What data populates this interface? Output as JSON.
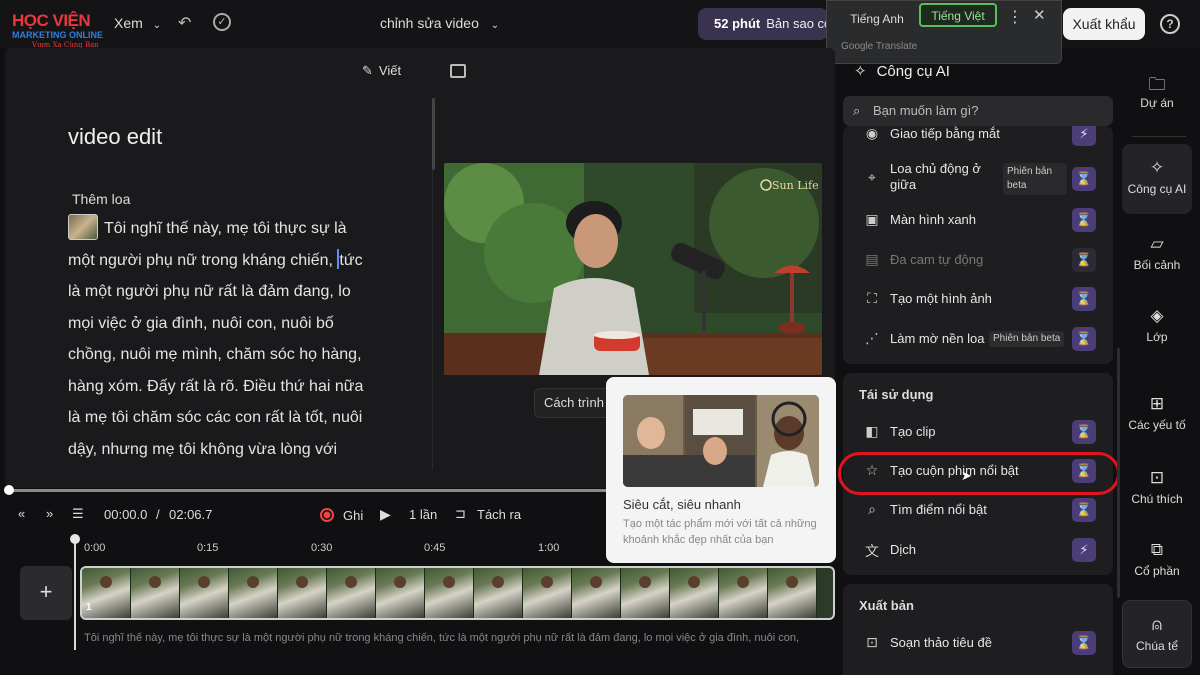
{
  "topbar": {
    "logo": {
      "line1": "HỌC VIỆN",
      "line2": "MARKETING ONLINE",
      "line3": "Vươn Xa Cùng Bạn"
    },
    "view_menu": "Xem",
    "document_title": "chỉnh sửa video",
    "duration": "52 phút",
    "duration_suffix": "Bản sao công",
    "export_label": "Xuất khẩu",
    "help_label": "?"
  },
  "translate_popup": {
    "lang_source": "Tiếng Anh",
    "lang_target": "Tiếng Việt",
    "brand": "Google Translate"
  },
  "editor": {
    "write_label": "Viết",
    "title": "video edit",
    "speaker": "Thêm loa",
    "transcript_before_cursor": "Tôi nghĩ thế này, mẹ tôi thực sự là một người phụ nữ trong kháng chiến, ",
    "transcript_after_cursor": "tức là một người phụ nữ rất là đảm đang, lo mọi việc ở gia đình, nuôi con, nuôi bố chồng, nuôi mẹ mình, chăm sóc họ hàng, hàng xóm. Đấy rất là rõ. Điều thứ hai nữa là mẹ tôi chăm sóc các con rất là tốt, nuôi dậy, nhưng mẹ tôi không vừa lòng với",
    "preview_watermark": "Sun Life",
    "script_button": "Cách trình bày"
  },
  "tooltip": {
    "heading": "Siêu cắt, siêu nhanh",
    "body": "Tạo một tác phẩm mới với tất cả những khoảnh khắc đẹp nhất của bạn"
  },
  "timeline": {
    "current_time": "00:00.0",
    "separator": "/",
    "total_time": "02:06.7",
    "record_label": "Ghi",
    "loop_label": "1 lần",
    "split_label": "Tách ra",
    "ruler": [
      "0:00",
      "0:15",
      "0:30",
      "0:45",
      "1:00"
    ],
    "add_label": "+",
    "clip_index": "1",
    "caption": "Tôi nghĩ thế này, mẹ tôi thực sự là một người phụ nữ trong kháng chiến, tức là một người phụ nữ rất là đảm đang, lo mọi việc ở gia đình, nuôi con,"
  },
  "ai_panel": {
    "title": "Công cụ AI",
    "search_placeholder": "Bạn muốn làm gì?",
    "tools": [
      {
        "label": "Giao tiếp bằng mắt",
        "icon": "eye-icon",
        "badge": "⚡"
      },
      {
        "label": "Loa chủ động ở giữa",
        "icon": "focus-icon",
        "beta": "Phiên bản beta",
        "badge": "⌛"
      },
      {
        "label": "Màn hình xanh",
        "icon": "green-screen-icon",
        "badge": "⌛"
      },
      {
        "label": "Đa cam tự động",
        "icon": "multicam-icon",
        "badge": "⌛"
      },
      {
        "label": "Tạo một hình ảnh",
        "icon": "image-icon",
        "badge": "⌛"
      },
      {
        "label": "Làm mờ nền loa",
        "icon": "blur-icon",
        "beta": "Phiên bản beta",
        "badge": "⌛"
      }
    ],
    "reuse_title": "Tái sử dụng",
    "reuse": [
      {
        "label": "Tạo clip",
        "icon": "clip-icon",
        "badge": "⌛"
      },
      {
        "label": "Tạo cuộn phim nổi bật",
        "icon": "star-icon",
        "badge": "⌛"
      },
      {
        "label": "Tìm điểm nổi bật",
        "icon": "search-icon",
        "badge": "⌛"
      },
      {
        "label": "Dịch",
        "icon": "translate-icon",
        "badge": "⚡"
      }
    ],
    "publish_title": "Xuất bản",
    "publish": [
      {
        "label": "Soạn thảo tiêu đề",
        "icon": "title-icon",
        "badge": "⌛"
      }
    ]
  },
  "nav": [
    {
      "label": "Dự án",
      "icon": "folder-icon"
    },
    {
      "label": "Công cụ AI",
      "icon": "sparkle-icon"
    },
    {
      "label": "Bối cảnh",
      "icon": "scene-icon"
    },
    {
      "label": "Lớp",
      "icon": "layers-icon"
    },
    {
      "label": "Các yếu tố",
      "icon": "elements-icon"
    },
    {
      "label": "Chú thích",
      "icon": "caption-icon"
    },
    {
      "label": "Cổ phần",
      "icon": "stock-icon"
    },
    {
      "label": "Chúa tể",
      "icon": "robot-icon"
    }
  ],
  "colors": {
    "accent": "#4b3e78",
    "highlight_ring": "#e0151f",
    "cursor": "#5f8df5"
  }
}
